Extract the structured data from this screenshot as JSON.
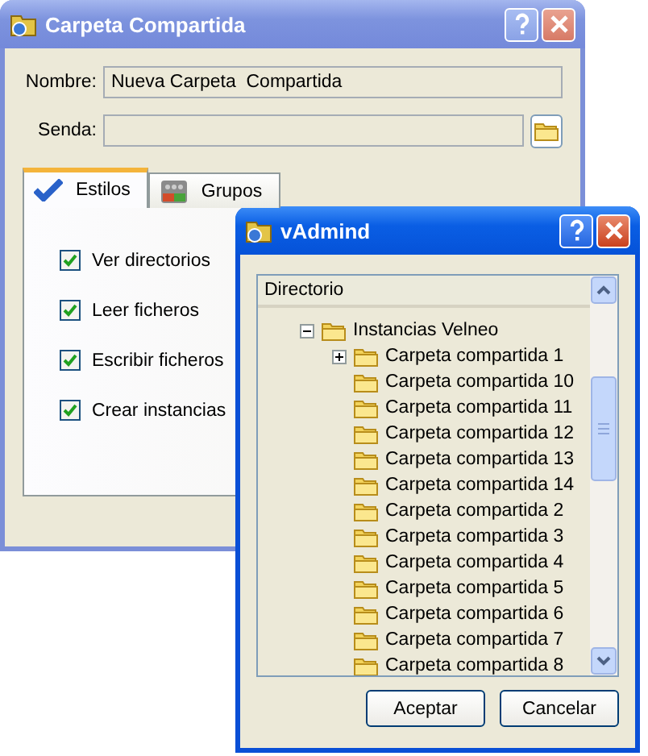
{
  "back_window": {
    "title": "Carpeta Compartida",
    "fields": [
      {
        "kind": "text",
        "label": "Nombre:",
        "value": "Nueva Carpeta  Compartida"
      },
      {
        "kind": "path",
        "label": "Senda:"
      }
    ],
    "tabs": [
      {
        "label": "Estilos",
        "selected": true
      },
      {
        "label": "Grupos",
        "selected": false
      }
    ],
    "checkboxes": [
      {
        "label": "Ver directorios",
        "checked": true
      },
      {
        "label": "Leer ficheros",
        "checked": true
      },
      {
        "label": "Escribir ficheros",
        "checked": true
      },
      {
        "label": "Crear instancias",
        "checked": true
      }
    ]
  },
  "front_window": {
    "title": "vAdmind",
    "tree": {
      "column": "Directorio",
      "items": [
        {
          "label": "Instancias Velneo",
          "expanded": true,
          "children": [
            {
              "label": "Carpeta compartida 1",
              "expanded": false,
              "has_children": true
            },
            {
              "label": "Carpeta compartida 10"
            },
            {
              "label": "Carpeta compartida 11"
            },
            {
              "label": "Carpeta compartida 12"
            },
            {
              "label": "Carpeta compartida 13"
            },
            {
              "label": "Carpeta compartida 14"
            },
            {
              "label": "Carpeta compartida 2"
            },
            {
              "label": "Carpeta compartida 3"
            },
            {
              "label": "Carpeta compartida 4"
            },
            {
              "label": "Carpeta compartida 5"
            },
            {
              "label": "Carpeta compartida 6"
            },
            {
              "label": "Carpeta compartida 7"
            },
            {
              "label": "Carpeta compartida 8"
            }
          ]
        }
      ]
    },
    "buttons": [
      "Aceptar",
      "Cancelar"
    ]
  }
}
